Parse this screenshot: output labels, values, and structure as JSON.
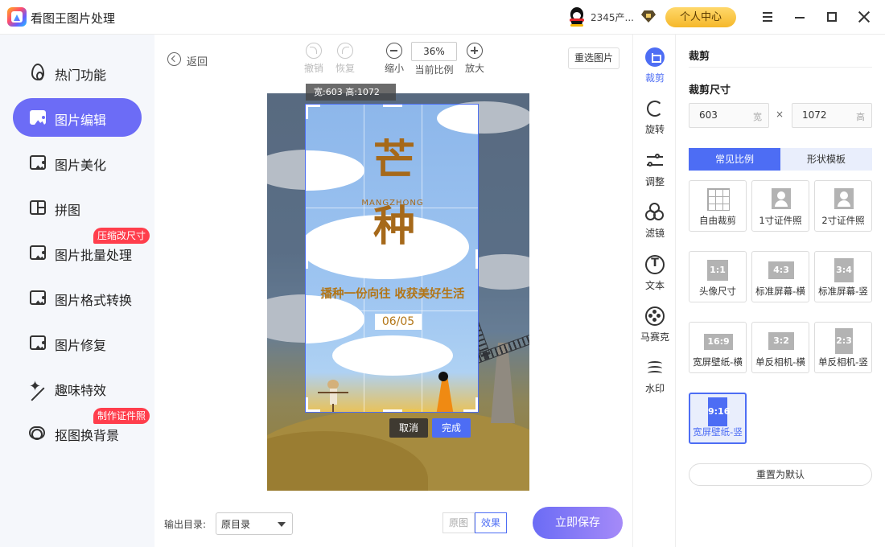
{
  "app": {
    "title": "看图王图片处理",
    "username": "2345产...",
    "profile_label": "个人中心"
  },
  "sidebar": {
    "items": [
      {
        "label": "热门功能"
      },
      {
        "label": "图片编辑"
      },
      {
        "label": "图片美化"
      },
      {
        "label": "拼图"
      },
      {
        "label": "图片批量处理",
        "badge": "压缩改尺寸"
      },
      {
        "label": "图片格式转换"
      },
      {
        "label": "图片修复"
      },
      {
        "label": "趣味特效"
      },
      {
        "label": "抠图换背景",
        "badge": "制作证件照"
      }
    ]
  },
  "toolbar": {
    "back_label": "返回",
    "undo_label": "撤销",
    "redo_label": "恢复",
    "zoom_out_label": "缩小",
    "zoom_value": "36%",
    "zoom_caption": "当前比例",
    "zoom_in_label": "放大",
    "reselect_label": "重选图片"
  },
  "canvas": {
    "dimension_label": "宽:603  高:1072",
    "poster": {
      "title_1": "芒",
      "title_2": "种",
      "subtitle": "MANGZHONG",
      "slogan": "播种一份向往  收获美好生活",
      "date": "06/05"
    },
    "cancel_label": "取消",
    "confirm_label": "完成"
  },
  "bottom": {
    "output_label": "输出目录:",
    "output_value": "原目录",
    "original_label": "原图",
    "effect_label": "效果",
    "save_label": "立即保存"
  },
  "rail": {
    "items": [
      {
        "label": "裁剪",
        "icon": "crop-icon"
      },
      {
        "label": "旋转",
        "icon": "rotate-icon"
      },
      {
        "label": "调整",
        "icon": "adjust-icon"
      },
      {
        "label": "滤镜",
        "icon": "filter-icon"
      },
      {
        "label": "文本",
        "icon": "text-icon"
      },
      {
        "label": "马赛克",
        "icon": "mosaic-icon"
      },
      {
        "label": "水印",
        "icon": "watermark-icon"
      }
    ]
  },
  "panel": {
    "title": "裁剪",
    "size_label": "裁剪尺寸",
    "width_value": "603",
    "width_unit": "宽",
    "height_value": "1072",
    "height_unit": "高",
    "times": "×",
    "tab_common": "常见比例",
    "tab_shape": "形状模板",
    "ratios": [
      {
        "label": "自由裁剪",
        "box": ""
      },
      {
        "label": "1寸证件照",
        "box": ""
      },
      {
        "label": "2寸证件照",
        "box": ""
      },
      {
        "label": "头像尺寸",
        "box": "1:1"
      },
      {
        "label": "标准屏幕-横",
        "box": "4:3"
      },
      {
        "label": "标准屏幕-竖",
        "box": "3:4"
      },
      {
        "label": "宽屏壁纸-横",
        "box": "16:9"
      },
      {
        "label": "单反相机-横",
        "box": "3:2"
      },
      {
        "label": "单反相机-竖",
        "box": "2:3"
      },
      {
        "label": "宽屏壁纸-竖",
        "box": "9:16"
      }
    ],
    "reset_label": "重置为默认"
  },
  "colors": {
    "accent": "#4d6df4",
    "sidebar_active": "#6c6cf6",
    "badge": "#ff3e4c",
    "profile": "#f5b82a"
  }
}
